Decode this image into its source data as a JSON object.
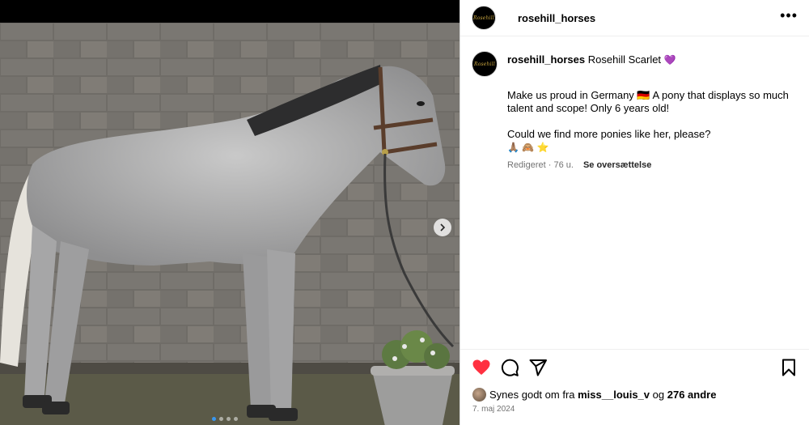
{
  "post": {
    "username": "rosehill_horses",
    "avatar_text": "Rosehill",
    "caption_title": "Rosehill Scarlet",
    "caption_emoji": "💜",
    "caption_line1": "Make us proud in Germany 🇩🇪 A pony that displays so much talent and scope! Only 6 years old!",
    "caption_line2": "Could we find more ponies like her, please?",
    "caption_emojis": "🙏🏽 🙈 ⭐",
    "edited_label": "Redigeret · 76 u.",
    "translate_label": "Se oversættelse",
    "liked_prefix": "Synes godt om fra",
    "liked_by": "miss__louis_v",
    "liked_joiner": "og",
    "liked_others": "276 andre",
    "date": "7. maj 2024"
  },
  "icons": {
    "more": "more-options-icon",
    "like": "heart-filled-icon",
    "comment": "comment-icon",
    "share": "share-icon",
    "save": "bookmark-icon",
    "next": "chevron-right-icon"
  },
  "colors": {
    "like": "#ff3040",
    "muted": "#737373",
    "divider": "#efefef",
    "carousel_active_dot": "#3897f0"
  },
  "media": {
    "image_count": 4,
    "active_index": 1
  }
}
